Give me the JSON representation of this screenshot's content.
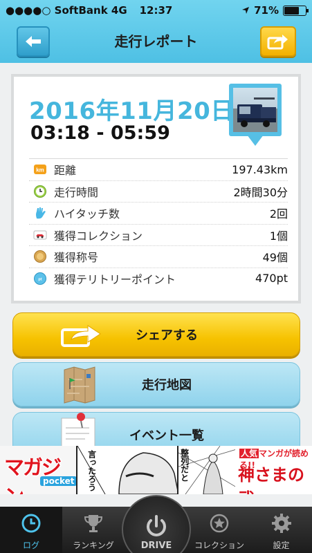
{
  "status_bar": {
    "carrier": "●●●●○ SoftBank  4G",
    "time": "12:37",
    "battery": "71%",
    "battery_level": 0.71
  },
  "header": {
    "title": "走行レポート",
    "back_icon": "arrow-left-icon",
    "share_icon": "share-icon"
  },
  "report": {
    "date": "2016年11月20日",
    "time_range": "03:18 - 05:59",
    "stats": [
      {
        "icon": "km-icon",
        "label": "距離",
        "value": "197.43km"
      },
      {
        "icon": "clock-icon",
        "label": "走行時間",
        "value": "2時間30分"
      },
      {
        "icon": "high-five-icon",
        "label": "ハイタッチ数",
        "value": "2回"
      },
      {
        "icon": "car-collection-icon",
        "label": "獲得コレクション",
        "value": "1個"
      },
      {
        "icon": "medal-icon",
        "label": "獲得称号",
        "value": "49個"
      },
      {
        "icon": "territory-point-icon",
        "label": "獲得テリトリーポイント",
        "value": "470pt"
      }
    ]
  },
  "buttons": {
    "share": "シェアする",
    "map": "走行地図",
    "events": "イベント一覧"
  },
  "ad": {
    "left_logo": "マガジン",
    "left_sub": "pocket",
    "speech1": "言ったろう",
    "speech2": "整列だと",
    "right_line1_a": "人気",
    "right_line1_b": "マンガ",
    "right_line1_c": "が読める!!",
    "right_line2": "神さまの弐"
  },
  "tabbar": {
    "log": "ログ",
    "ranking": "ランキング",
    "drive": "DRIVE",
    "collection": "コレクション",
    "settings": "設定"
  },
  "colors": {
    "header": "#4ec0e4",
    "date_blue": "#45b6dd",
    "share_yellow": "#f6c200",
    "light_blue_button": "#93d5ed",
    "tab_active": "#4ec3ec"
  }
}
